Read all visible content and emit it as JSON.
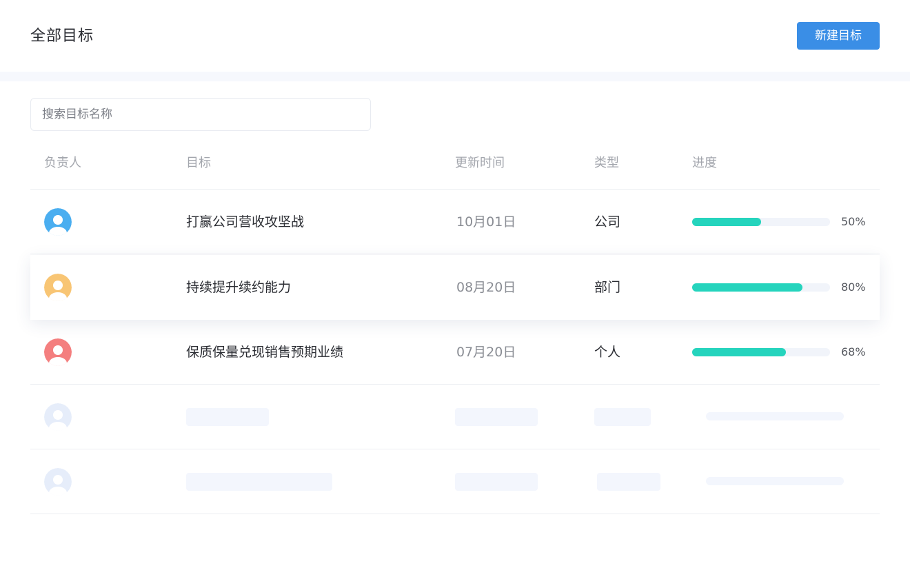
{
  "header": {
    "title": "全部目标",
    "new_button": "新建目标"
  },
  "search": {
    "placeholder": "搜索目标名称",
    "value": ""
  },
  "table": {
    "columns": [
      "负责人",
      "目标",
      "更新时间",
      "类型",
      "进度"
    ],
    "rows": [
      {
        "avatar_icon": "user-avatar-icon",
        "avatar_color": "#4aaef0",
        "goal": "打赢公司营收攻坚战",
        "updated": "10月01日",
        "type": "公司",
        "progress": 50,
        "progress_label": "50%"
      },
      {
        "avatar_icon": "user-avatar-icon",
        "avatar_color": "#f8c574",
        "goal": "持续提升续约能力",
        "updated": "08月20日",
        "type": "部门",
        "progress": 80,
        "progress_label": "80%"
      },
      {
        "avatar_icon": "user-avatar-icon",
        "avatar_color": "#f47f7f",
        "goal": "保质保量兑现销售预期业绩",
        "updated": "07月20日",
        "type": "个人",
        "progress": 68,
        "progress_label": "68%"
      }
    ],
    "placeholder_rows": 2
  },
  "colors": {
    "accent": "#3a8ee6",
    "progress_fill": "#25d4bd",
    "progress_track": "#f1f4fa",
    "skeleton": "#f3f6fd",
    "skeleton_avatar": "#e6edfa"
  }
}
